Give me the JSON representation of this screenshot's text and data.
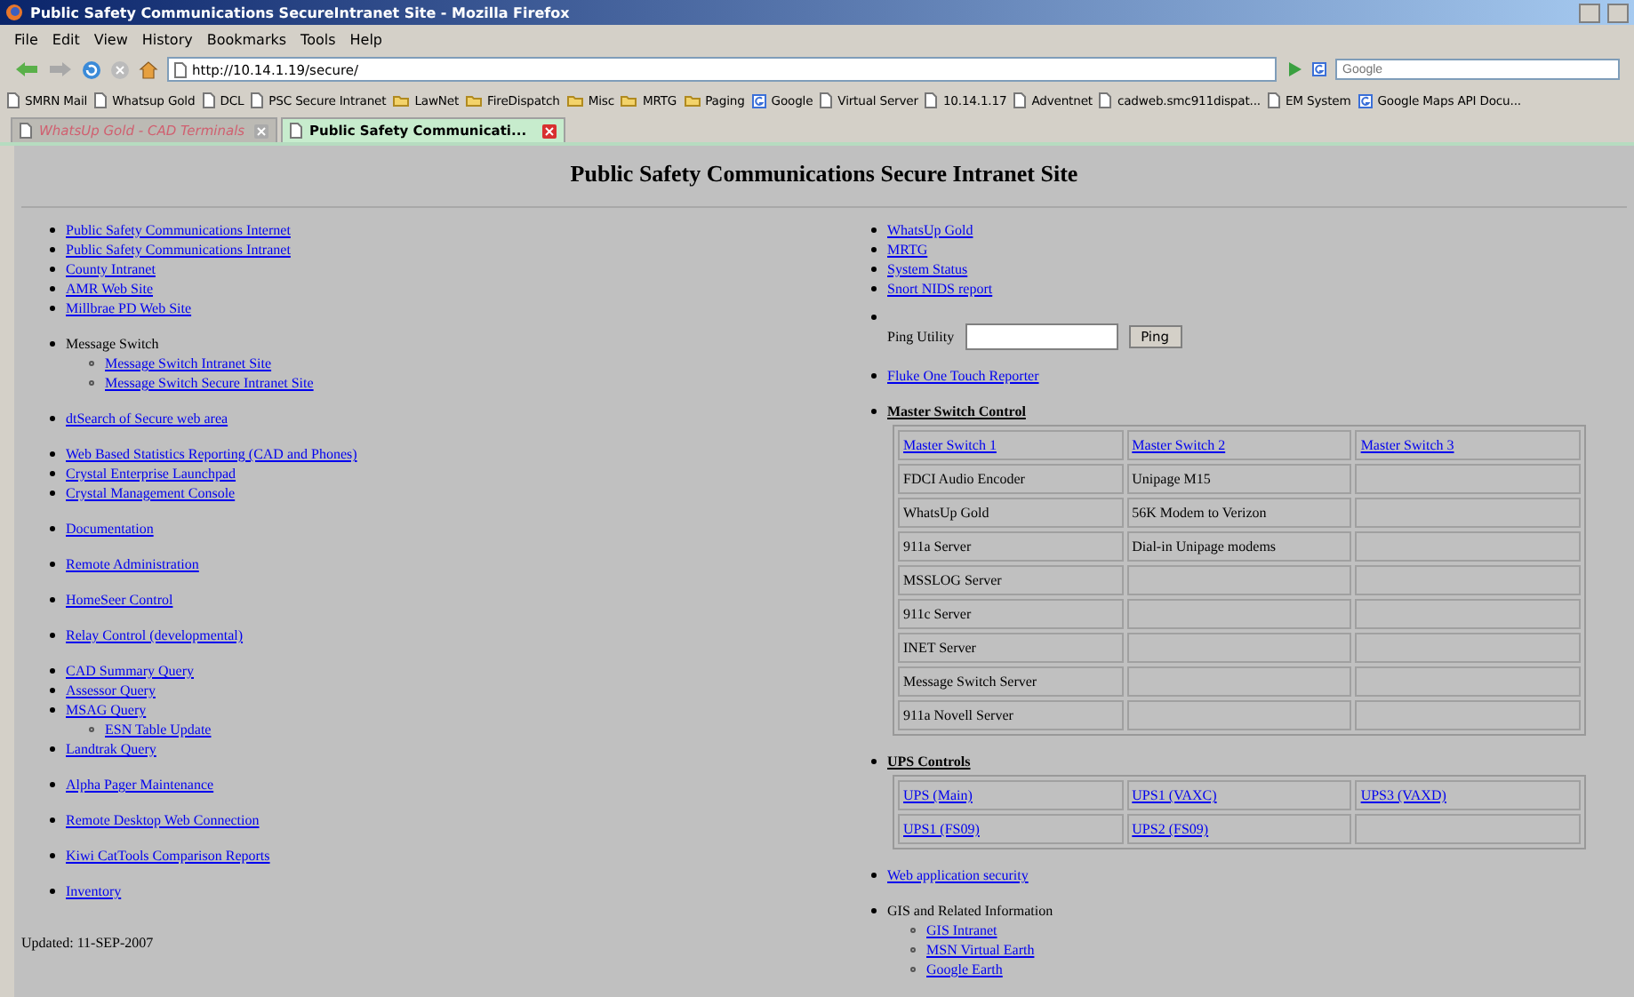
{
  "window": {
    "title": "Public Safety Communications SecureIntranet Site - Mozilla Firefox"
  },
  "menu": [
    "File",
    "Edit",
    "View",
    "History",
    "Bookmarks",
    "Tools",
    "Help"
  ],
  "address": {
    "value": "http://10.14.1.19/secure/"
  },
  "search": {
    "placeholder": "Google"
  },
  "bookmarks": [
    {
      "label": "SMRN Mail",
      "kind": "page"
    },
    {
      "label": "Whatsup Gold",
      "kind": "page"
    },
    {
      "label": "DCL",
      "kind": "page"
    },
    {
      "label": "PSC Secure Intranet",
      "kind": "page"
    },
    {
      "label": "LawNet",
      "kind": "folder"
    },
    {
      "label": "FireDispatch",
      "kind": "folder"
    },
    {
      "label": "Misc",
      "kind": "folder"
    },
    {
      "label": "MRTG",
      "kind": "folder"
    },
    {
      "label": "Paging",
      "kind": "folder"
    },
    {
      "label": "Google",
      "kind": "google"
    },
    {
      "label": "Virtual Server",
      "kind": "page"
    },
    {
      "label": "10.14.1.17",
      "kind": "page"
    },
    {
      "label": "Adventnet",
      "kind": "page"
    },
    {
      "label": "cadweb.smc911dispat...",
      "kind": "page"
    },
    {
      "label": "EM System",
      "kind": "page"
    },
    {
      "label": "Google Maps API Docu...",
      "kind": "google"
    }
  ],
  "tabs": [
    {
      "label": "WhatsUp Gold - CAD Terminals",
      "selected": false
    },
    {
      "label": "Public Safety Communicati...",
      "selected": true
    }
  ],
  "page": {
    "heading": "Public Safety Communications Secure Intranet Site",
    "left_groups": [
      {
        "items": [
          {
            "text": "Public Safety Communications Internet",
            "kind": "link"
          },
          {
            "text": "Public Safety Communications Intranet",
            "kind": "link"
          },
          {
            "text": "County Intranet",
            "kind": "link"
          },
          {
            "text": "AMR Web Site",
            "kind": "link"
          },
          {
            "text": "Millbrae PD Web Site",
            "kind": "link"
          }
        ]
      },
      {
        "items": [
          {
            "text": "Message Switch",
            "kind": "text",
            "children": [
              {
                "text": "Message Switch Intranet Site",
                "kind": "link"
              },
              {
                "text": "Message Switch Secure Intranet Site",
                "kind": "link"
              }
            ]
          }
        ]
      },
      {
        "items": [
          {
            "text": "dtSearch of Secure web area",
            "kind": "link"
          }
        ]
      },
      {
        "items": [
          {
            "text": "Web Based Statistics Reporting (CAD and Phones)",
            "kind": "link"
          },
          {
            "text": "Crystal Enterprise Launchpad",
            "kind": "link"
          },
          {
            "text": "Crystal Management Console",
            "kind": "link"
          }
        ]
      },
      {
        "items": [
          {
            "text": "Documentation",
            "kind": "link"
          }
        ]
      },
      {
        "items": [
          {
            "text": "Remote Administration",
            "kind": "link"
          }
        ]
      },
      {
        "items": [
          {
            "text": "HomeSeer Control",
            "kind": "link"
          }
        ]
      },
      {
        "items": [
          {
            "text": "Relay Control (developmental)",
            "kind": "link"
          }
        ]
      },
      {
        "items": [
          {
            "text": "CAD Summary Query",
            "kind": "link"
          },
          {
            "text": "Assessor Query",
            "kind": "link"
          },
          {
            "text": "MSAG Query",
            "kind": "link",
            "children": [
              {
                "text": "ESN Table Update",
                "kind": "link"
              }
            ]
          },
          {
            "text": "Landtrak Query",
            "kind": "link"
          }
        ]
      },
      {
        "items": [
          {
            "text": "Alpha Pager Maintenance",
            "kind": "link"
          }
        ]
      },
      {
        "items": [
          {
            "text": "Remote Desktop Web Connection",
            "kind": "link"
          }
        ]
      },
      {
        "items": [
          {
            "text": "Kiwi CatTools Comparison Reports",
            "kind": "link"
          }
        ]
      },
      {
        "items": [
          {
            "text": "Inventory",
            "kind": "link"
          }
        ]
      }
    ],
    "updated": "Updated: 11-SEP-2007",
    "right_sections": [
      {
        "kind": "links",
        "items": [
          {
            "text": "WhatsUp Gold",
            "kind": "link"
          },
          {
            "text": "MRTG",
            "kind": "link"
          },
          {
            "text": "System Status",
            "kind": "link"
          },
          {
            "text": "Snort NIDS report",
            "kind": "link"
          }
        ]
      },
      {
        "kind": "ping",
        "label": "Ping Utility",
        "button": "Ping"
      },
      {
        "kind": "links",
        "items": [
          {
            "text": "Fluke One Touch Reporter",
            "kind": "link"
          }
        ]
      },
      {
        "kind": "table",
        "title": "Master Switch Control",
        "rows": [
          [
            {
              "text": "Master Switch 1",
              "kind": "link"
            },
            {
              "text": "Master Switch 2",
              "kind": "link"
            },
            {
              "text": "Master Switch 3",
              "kind": "link"
            }
          ],
          [
            {
              "text": "FDCI Audio Encoder",
              "kind": "text"
            },
            {
              "text": "Unipage M15",
              "kind": "text"
            },
            {}
          ],
          [
            {
              "text": "WhatsUp Gold",
              "kind": "text"
            },
            {
              "text": "56K Modem to Verizon",
              "kind": "text"
            },
            {}
          ],
          [
            {
              "text": "911a Server",
              "kind": "text"
            },
            {
              "text": "Dial-in Unipage modems",
              "kind": "text"
            },
            {}
          ],
          [
            {
              "text": "MSSLOG Server",
              "kind": "text"
            },
            {},
            {}
          ],
          [
            {
              "text": "911c Server",
              "kind": "text"
            },
            {},
            {}
          ],
          [
            {
              "text": "INET Server",
              "kind": "text"
            },
            {},
            {}
          ],
          [
            {
              "text": "Message Switch Server",
              "kind": "text"
            },
            {},
            {}
          ],
          [
            {
              "text": "911a Novell Server",
              "kind": "text"
            },
            {},
            {}
          ]
        ]
      },
      {
        "kind": "table",
        "title": "UPS Controls",
        "rows": [
          [
            {
              "text": "UPS (Main)",
              "kind": "link"
            },
            {
              "text": "UPS1 (VAXC)",
              "kind": "link"
            },
            {
              "text": "UPS3 (VAXD)",
              "kind": "link"
            }
          ],
          [
            {
              "text": "UPS1 (FS09)",
              "kind": "link"
            },
            {
              "text": "UPS2 (FS09)",
              "kind": "link"
            },
            {}
          ]
        ]
      },
      {
        "kind": "links",
        "items": [
          {
            "text": "Web application security",
            "kind": "link"
          }
        ]
      },
      {
        "kind": "links",
        "items": [
          {
            "text": "GIS and Related Information",
            "kind": "text",
            "children": [
              {
                "text": "GIS Intranet",
                "kind": "link"
              },
              {
                "text": "MSN Virtual Earth",
                "kind": "link"
              },
              {
                "text": "Google Earth",
                "kind": "link"
              }
            ]
          }
        ]
      }
    ]
  }
}
